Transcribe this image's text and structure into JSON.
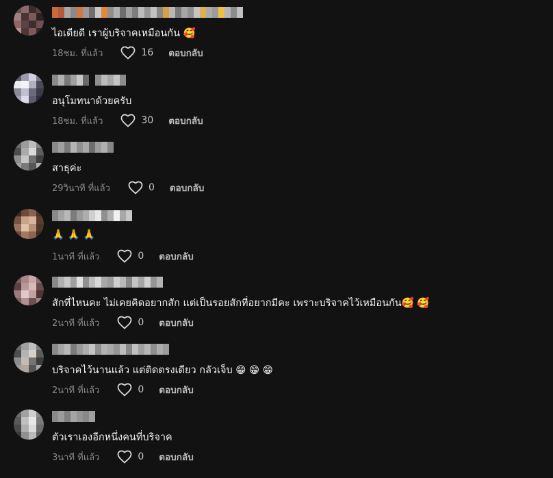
{
  "comments": [
    {
      "text": "ไอเดียดี เราผู้บริจาคเหมือนกัน 🥰",
      "time": "18ชม. ที่แล้ว",
      "likes": "16",
      "reply": "ตอบกลับ",
      "avatar_colors": [
        "#6b4e4e",
        "#8a6a6a",
        "#3a2c2c",
        "#5a3f3f",
        "#a08080",
        "#4a3434",
        "#7a5a5a",
        "#2e2222",
        "#906666",
        "#5c4444",
        "#3e2e2e",
        "#6e5050",
        "#b89090",
        "#4c3838",
        "#805858",
        "#362828"
      ],
      "username_colors": [
        "#c96a3a",
        "#b45a3a",
        "#a8a8a8",
        "#8a8a8a",
        "#d07a40",
        "#9a9a9a",
        "#707070",
        "#c8c8c8",
        "#e08a3a",
        "#8f8f8f",
        "#b0b0b0",
        "#6d6d6d",
        "#a0a0a0",
        "#7d7d7d",
        "#bcbcbc",
        "#969696",
        "#c2c2c2",
        "#888888",
        "#d8a040",
        "#b8b8b8",
        "#7a7a7a",
        "#a6a6a6",
        "#909090",
        "#c4c4c4",
        "#e0b050",
        "#aaaaaa",
        "#9c9c9c",
        "#f0c040",
        "#b6b6b6",
        "#8c8c8c",
        "#c0c0c0"
      ]
    },
    {
      "text": "อนุโมทนาด้วยครับ",
      "time": "18ชม. ที่แล้ว",
      "likes": "30",
      "reply": "ตอบกลับ",
      "avatar_colors": [
        "#5a5a6a",
        "#9a9aaa",
        "#d0d0e0",
        "#7a7a8a",
        "#ececf0",
        "#f4f4f8",
        "#b0b0c0",
        "#4a4a5a",
        "#8a8a9a",
        "#c0c0d0",
        "#6a6a7a",
        "#3a3a4a",
        "#a0a0b0",
        "#dcdce8",
        "#5c5c6c",
        "#2c2c3c"
      ],
      "username_colors": [
        "#8a8a8a",
        "#b0b0b0",
        "#7a7a7a",
        "#a0a0a0",
        "#c8c8c8",
        "#6a6a6a",
        "#121212",
        "#909090",
        "#bcbcbc",
        "#a8a8a8",
        "#c4c4c4",
        "#8c8c8c"
      ]
    },
    {
      "text": "สาธุค่ะ",
      "time": "29วินาที ที่แล้ว",
      "likes": "0",
      "reply": "ตอบกลับ",
      "avatar_colors": [
        "#6a6a6a",
        "#9a9a9a",
        "#bdbdbd",
        "#808080",
        "#4c4c4c",
        "#aaaaaa",
        "#dadada",
        "#5e5e5e",
        "#8e8e8e",
        "#c6c6c6",
        "#707070",
        "#3e3e3e",
        "#a4a4a4",
        "#7a7a7a",
        "#565656",
        "#b4b4b4"
      ],
      "username_colors": [
        "#8a8a8a",
        "#a0a0a0",
        "#7a7a7a",
        "#b4b4b4",
        "#909090",
        "#a8a8a8",
        "#6e6e6e",
        "#9c9c9c",
        "#b0b0b0",
        "#868686"
      ]
    },
    {
      "text": "🙏 🙏 🙏",
      "time": "1นาที ที่แล้ว",
      "likes": "0",
      "reply": "ตอบกลับ",
      "avatar_colors": [
        "#3a2a24",
        "#6e4a3a",
        "#8a6050",
        "#4a3428",
        "#7a5242",
        "#c8a48c",
        "#d8b49c",
        "#5a3c30",
        "#9a7060",
        "#e0c0a8",
        "#b89078",
        "#4e362a",
        "#6a4838",
        "#a07864",
        "#8c6452",
        "#3e2c22"
      ],
      "username_colors": [
        "#8a8a8a",
        "#a4a4a4",
        "#b8b8b8",
        "#7c7c7c",
        "#9a9a9a",
        "#aeaeae",
        "#cfcfcf",
        "#e8e8e8",
        "#909090",
        "#b2b2b2",
        "#f0f0f0",
        "#a8a8a8",
        "#c8c8c8"
      ]
    },
    {
      "text": "สักที่ไหนคะ ไม่เคยคิดอยากสัก แต่เป็นรอยสักที่อยากมีคะ เพราะบริจาคไว้เหมือนกัน🥰 🥰",
      "time": "2นาที ที่แล้ว",
      "likes": "0",
      "reply": "ตอบกลับ",
      "avatar_colors": [
        "#7a5a5a",
        "#a88888",
        "#c8a8a8",
        "#8a6a6a",
        "#5a4040",
        "#b89898",
        "#d8b8b8",
        "#6a4a4a",
        "#9a7a7a",
        "#e0c8c8",
        "#c0a0a0",
        "#4a3434",
        "#806060",
        "#b09090",
        "#705050",
        "#a08080"
      ],
      "username_colors": [
        "#8a8a8a",
        "#b0b0b0",
        "#c8c8c8",
        "#a0a0a0",
        "#e0e0e0",
        "#909090",
        "#bcbcbc",
        "#d8d8d8",
        "#a8a8a8",
        "#9c9c9c",
        "#cfcfcf",
        "#b8b8b8",
        "#888888",
        "#c4c4c4",
        "#a6a6a6",
        "#d0d0d0",
        "#969696",
        "#b4b4b4"
      ]
    },
    {
      "text": "บริจาคไว้นานแล้ว แต่ติดตรงเดียว กลัวเจ็บ 😁 😁 😁",
      "time": "2นาที ที่แล้ว",
      "likes": "0",
      "reply": "ตอบกลับ",
      "avatar_colors": [
        "#6a6a6a",
        "#a0a0a0",
        "#bfbfbf",
        "#7a7a7a",
        "#4e4e4e",
        "#b4b4b4",
        "#d8d0c8",
        "#5c5c5c",
        "#8c8c8c",
        "#c4bcb4",
        "#747474",
        "#3c3c3c",
        "#9e9e9e",
        "#b0a8a0",
        "#565656",
        "#aaaaaa"
      ],
      "username_colors": [
        "#8a8a8a",
        "#a4a4a4",
        "#b8b8b8",
        "#7c7c7c",
        "#9a9a9a",
        "#aeaeae",
        "#c4c4c4",
        "#909090",
        "#b2b2b2",
        "#a8a8a8",
        "#969696",
        "#bcbcbc",
        "#888888",
        "#c0c0c0",
        "#a0a0a0",
        "#b6b6b6",
        "#8e8e8e",
        "#acacac",
        "#9c9c9c"
      ]
    },
    {
      "text": "ตัวเราเองอีกหนึ่งคนที่บริจาค",
      "time": "3นาที ที่แล้ว",
      "likes": "0",
      "reply": "ตอบกลับ",
      "avatar_colors": [
        "#6a6a6a",
        "#a0a0a0",
        "#d0d0d0",
        "#8a8a8a",
        "#5a5a5a",
        "#c0c0c0",
        "#e8e8e8",
        "#7a7a7a",
        "#4a4a4a",
        "#b0b0b0",
        "#dcdcdc",
        "#6c6c6c",
        "#3a3a3a",
        "#909090",
        "#bababa",
        "#5c5c5c"
      ],
      "username_colors": [
        "#8a8a8a",
        "#9c9c9c",
        "#808080",
        "#a4a4a4",
        "#949494",
        "#888888",
        "#a0a0a0"
      ]
    }
  ],
  "colors": {
    "background": "#121212",
    "text": "#f1f1f1",
    "meta": "#8a8a8a",
    "reply": "#bdbdbd"
  },
  "icons": {
    "like": "heart-outline-icon"
  }
}
